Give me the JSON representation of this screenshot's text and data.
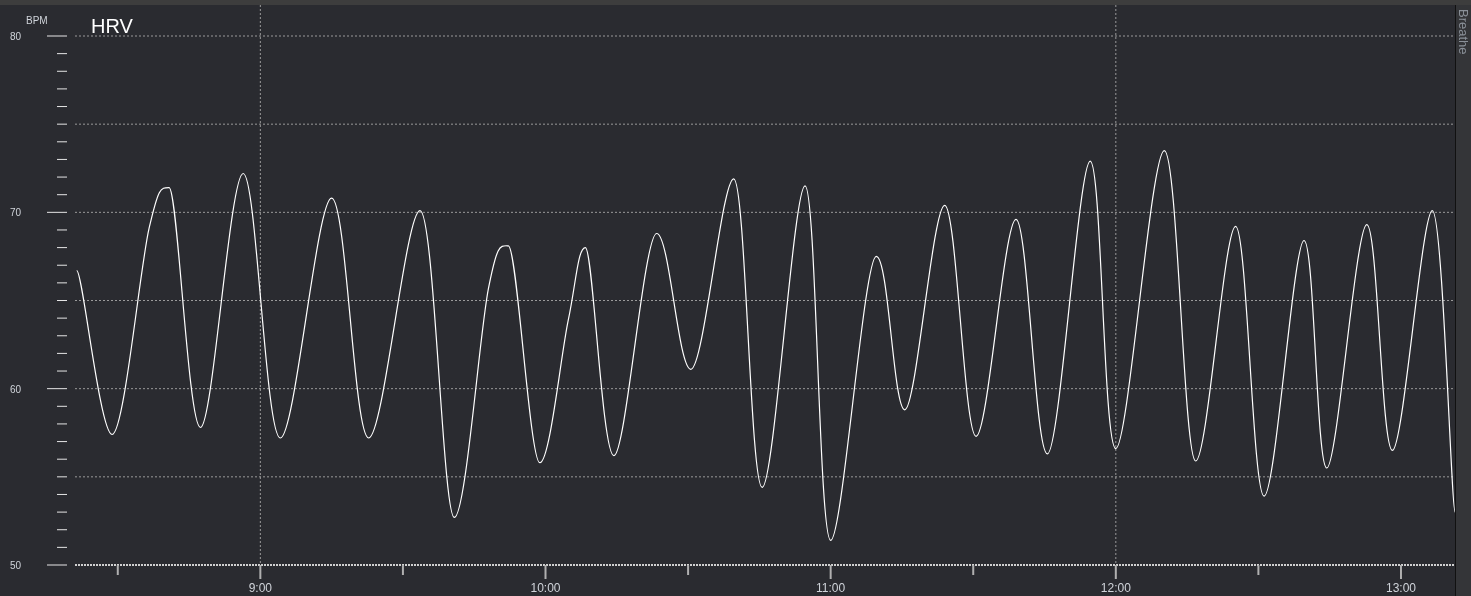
{
  "side_tab": {
    "label": "Breathe"
  },
  "chart": {
    "chart_data": {
      "type": "line",
      "title": "HRV",
      "ylabel": "BPM",
      "x": [
        8.356,
        8.48,
        8.61,
        8.68,
        8.79,
        8.94,
        9.07,
        9.25,
        9.38,
        9.56,
        9.68,
        9.8,
        9.87,
        9.98,
        10.08,
        10.14,
        10.24,
        10.39,
        10.51,
        10.66,
        10.76,
        10.91,
        11.0,
        11.16,
        11.26,
        11.4,
        11.51,
        11.65,
        11.76,
        11.91,
        12.0,
        12.17,
        12.28,
        12.42,
        12.52,
        12.66,
        12.74,
        12.88,
        12.97,
        13.11,
        13.19
      ],
      "series": [
        {
          "color": "#ffffff",
          "values": [
            66.7,
            57.4,
            69.1,
            71.4,
            57.8,
            72.2,
            57.2,
            70.8,
            57.2,
            70.1,
            52.7,
            65.7,
            68.1,
            55.8,
            63.9,
            68.0,
            56.2,
            68.8,
            61.1,
            71.9,
            54.4,
            71.5,
            51.4,
            67.5,
            58.8,
            70.4,
            57.3,
            69.6,
            56.3,
            72.9,
            56.6,
            73.5,
            55.9,
            69.2,
            53.9,
            68.4,
            55.5,
            69.3,
            56.5,
            70.1,
            53.0
          ]
        }
      ],
      "xlim": [
        8.35,
        13.2
      ],
      "ylim": [
        50,
        80
      ],
      "xticks": [
        {
          "value": 9,
          "label": "9:00"
        },
        {
          "value": 10,
          "label": "10:00"
        },
        {
          "value": 11,
          "label": "11:00"
        },
        {
          "value": 12,
          "label": "12:00"
        },
        {
          "value": 13,
          "label": "13:00"
        }
      ],
      "yticks": [
        50,
        60,
        70,
        80
      ],
      "grid": true
    }
  }
}
